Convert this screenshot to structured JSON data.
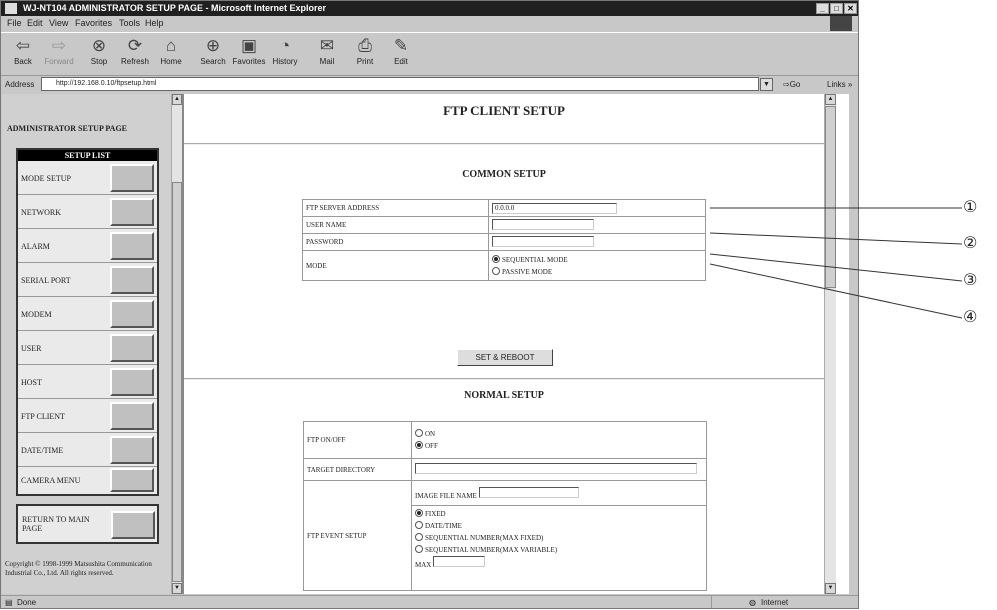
{
  "window": {
    "title": "WJ-NT104 ADMINISTRATOR SETUP PAGE - Microsoft Internet Explorer"
  },
  "menu": [
    "File",
    "Edit",
    "View",
    "Favorites",
    "Tools",
    "Help"
  ],
  "toolbar": [
    {
      "label": "Back",
      "icon": "back-arrow-icon"
    },
    {
      "label": "Forward",
      "icon": "forward-arrow-icon"
    },
    {
      "label": "Stop",
      "icon": "stop-icon"
    },
    {
      "label": "Refresh",
      "icon": "refresh-icon"
    },
    {
      "label": "Home",
      "icon": "home-icon"
    },
    {
      "label": "Search",
      "icon": "search-icon"
    },
    {
      "label": "Favorites",
      "icon": "favorites-icon"
    },
    {
      "label": "History",
      "icon": "history-icon"
    },
    {
      "label": "Mail",
      "icon": "mail-icon"
    },
    {
      "label": "Print",
      "icon": "print-icon"
    },
    {
      "label": "Edit",
      "icon": "edit-icon"
    }
  ],
  "address": {
    "label": "Address",
    "url": "http://192.168.0.10/ftpsetup.html",
    "go": "Go",
    "links": "Links"
  },
  "sidebar": {
    "heading": "ADMINISTRATOR SETUP PAGE",
    "list_title": "SETUP LIST",
    "items": [
      "MODE SETUP",
      "NETWORK",
      "ALARM",
      "SERIAL PORT",
      "MODEM",
      "USER",
      "HOST",
      "FTP CLIENT",
      "DATE/TIME",
      "CAMERA MENU"
    ],
    "return_label": "RETURN TO MAIN PAGE",
    "copyright": "Copyright © 1998-1999 Matsushita Communication Industrial Co., Ltd. All rights reserved."
  },
  "page": {
    "title": "FTP CLIENT SETUP",
    "common": {
      "heading": "COMMON SETUP",
      "server_label": "FTP SERVER ADDRESS",
      "server_value": "0.0.0.0",
      "user_label": "USER NAME",
      "password_label": "PASSWORD",
      "mode_label": "MODE",
      "mode_options": [
        "SEQUENTIAL MODE",
        "PASSIVE MODE"
      ],
      "button": "SET & REBOOT"
    },
    "normal": {
      "heading": "NORMAL SETUP",
      "onoff_label": "FTP ON/OFF",
      "onoff_options": [
        "ON",
        "OFF"
      ],
      "target_label": "TARGET DIRECTORY",
      "event_label": "FTP EVENT SETUP",
      "image_file_label": "IMAGE FILE NAME",
      "event_options": [
        "FIXED",
        "DATE/TIME",
        "SEQUENTIAL NUMBER(MAX FIXED)",
        "SEQUENTIAL NUMBER(MAX VARIABLE)"
      ],
      "max_label": "MAX"
    }
  },
  "callouts": [
    "①",
    "②",
    "③",
    "④"
  ],
  "status": {
    "left": "Done",
    "zone": "Internet"
  }
}
